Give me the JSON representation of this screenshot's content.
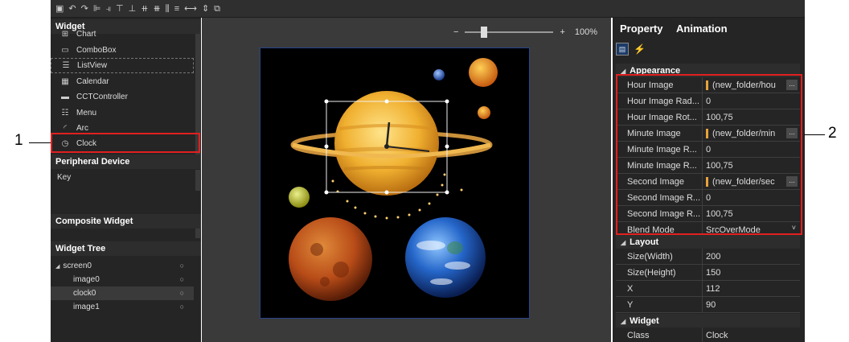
{
  "callouts": {
    "left": "1",
    "right": "2"
  },
  "toolbar": {
    "icons": [
      "save-icon",
      "undo-icon",
      "redo-icon",
      "align-left-icon",
      "align-right-icon",
      "align-top-icon",
      "align-bottom-icon",
      "align-center-v-icon",
      "align-center-h-icon",
      "distribute-h-icon",
      "distribute-v-icon",
      "space-h-icon",
      "space-v-icon",
      "same-size-icon"
    ]
  },
  "widget_panel": {
    "header": "Widget",
    "items": [
      {
        "label": "Chart",
        "icon": "chart-icon"
      },
      {
        "label": "ComboBox",
        "icon": "combobox-icon"
      },
      {
        "label": "ListView",
        "icon": "listview-icon"
      },
      {
        "label": "Calendar",
        "icon": "calendar-icon"
      },
      {
        "label": "CCTController",
        "icon": "cct-controller-icon"
      },
      {
        "label": "Menu",
        "icon": "menu-icon"
      },
      {
        "label": "Arc",
        "icon": "arc-icon"
      },
      {
        "label": "Clock",
        "icon": "clock-icon"
      }
    ],
    "peripheral_header": "Peripheral Device",
    "peripheral_items": [
      "Key"
    ],
    "composite_header": "Composite Widget",
    "tree_header": "Widget Tree",
    "tree": [
      {
        "label": "screen0"
      },
      {
        "label": "image0"
      },
      {
        "label": "clock0"
      },
      {
        "label": "image1"
      }
    ]
  },
  "canvas": {
    "zoom_minus": "−",
    "zoom_plus": "+",
    "zoom_label": "100%",
    "zoom_level": 0.2
  },
  "property_panel": {
    "tab_property": "Property",
    "tab_animation": "Animation",
    "sections": {
      "appearance": "Appearance",
      "layout": "Layout",
      "widget": "Widget"
    },
    "appearance_rows": [
      {
        "name": "Hour Image",
        "value": "(new_folder/hou",
        "kind": "image"
      },
      {
        "name": "Hour Image Rad...",
        "value": "0",
        "kind": "text"
      },
      {
        "name": "Hour Image Rot...",
        "value": "100,75",
        "kind": "text"
      },
      {
        "name": "Minute Image",
        "value": "(new_folder/min",
        "kind": "image"
      },
      {
        "name": "Minute Image R...",
        "value": "0",
        "kind": "text"
      },
      {
        "name": "Minute Image R...",
        "value": "100,75",
        "kind": "text"
      },
      {
        "name": "Second Image",
        "value": "(new_folder/sec",
        "kind": "image"
      },
      {
        "name": "Second Image R...",
        "value": "0",
        "kind": "text"
      },
      {
        "name": "Second Image R...",
        "value": "100,75",
        "kind": "text"
      },
      {
        "name": "Blend Mode",
        "value": "SrcOverMode",
        "kind": "select"
      }
    ],
    "layout_rows": [
      {
        "name": "Size(Width)",
        "value": "200"
      },
      {
        "name": "Size(Height)",
        "value": "150"
      },
      {
        "name": "X",
        "value": "112"
      },
      {
        "name": "Y",
        "value": "90"
      }
    ],
    "widget_rows": [
      {
        "name": "Class",
        "value": "Clock"
      }
    ]
  },
  "colors": {
    "highlight": "#e02020",
    "panel": "#252526",
    "canvas": "#3a3a3a"
  }
}
